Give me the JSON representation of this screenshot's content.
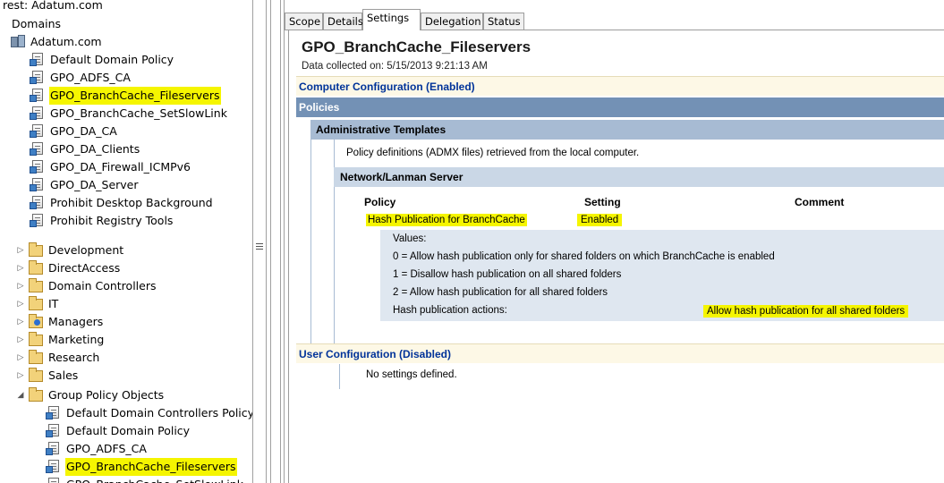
{
  "tree": {
    "partial_top": "rest: Adatum.com",
    "domains_label": "Domains",
    "domain_name": "Adatum.com",
    "linked_gpos": [
      {
        "label": "Default Domain Policy",
        "highlighted": false
      },
      {
        "label": "GPO_ADFS_CA",
        "highlighted": false
      },
      {
        "label": "GPO_BranchCache_Fileservers",
        "highlighted": true
      },
      {
        "label": "GPO_BranchCache_SetSlowLink",
        "highlighted": false
      },
      {
        "label": "GPO_DA_CA",
        "highlighted": false
      },
      {
        "label": "GPO_DA_Clients",
        "highlighted": false
      },
      {
        "label": "GPO_DA_Firewall_ICMPv6",
        "highlighted": false
      },
      {
        "label": "GPO_DA_Server",
        "highlighted": false
      },
      {
        "label": "Prohibit Desktop Background",
        "highlighted": false
      },
      {
        "label": "Prohibit Registry Tools",
        "highlighted": false
      }
    ],
    "ous": [
      {
        "label": "Development",
        "icon": "ou-icon"
      },
      {
        "label": "DirectAccess",
        "icon": "ou-icon"
      },
      {
        "label": "Domain Controllers",
        "icon": "ou-icon"
      },
      {
        "label": "IT",
        "icon": "ou-icon"
      },
      {
        "label": "Managers",
        "icon": "ou-icon-blue"
      },
      {
        "label": "Marketing",
        "icon": "ou-icon"
      },
      {
        "label": "Research",
        "icon": "ou-icon"
      },
      {
        "label": "Sales",
        "icon": "ou-icon"
      }
    ],
    "gpo_folder": "Group Policy Objects",
    "gpo_objects": [
      {
        "label": "Default Domain Controllers Policy",
        "highlighted": false
      },
      {
        "label": "Default Domain Policy",
        "highlighted": false
      },
      {
        "label": "GPO_ADFS_CA",
        "highlighted": false
      },
      {
        "label": "GPO_BranchCache_Fileservers",
        "highlighted": true
      },
      {
        "label": "GPO_BranchCache_SetSlowLink",
        "highlighted": false
      }
    ]
  },
  "tabs": [
    "Scope",
    "Details",
    "Settings",
    "Delegation",
    "Status"
  ],
  "active_tab": "Settings",
  "report": {
    "title": "GPO_BranchCache_Fileservers",
    "collected": "Data collected on: 5/15/2013 9:21:13 AM",
    "computer_config": "Computer Configuration (Enabled)",
    "policies": "Policies",
    "admin_templates": "Administrative Templates",
    "admx_note": "Policy definitions (ADMX files) retrieved from the local computer.",
    "network_section": "Network/Lanman Server",
    "col_policy": "Policy",
    "col_setting": "Setting",
    "col_comment": "Comment",
    "policy_name": "Hash Publication for BranchCache",
    "policy_setting": "Enabled",
    "values_label": "Values:",
    "value_0": "0 = Allow hash publication only for shared folders on which BranchCache is enabled",
    "value_1": "1 = Disallow hash publication on all shared folders",
    "value_2": "2 = Allow hash publication for all shared folders",
    "actions_label": "Hash publication actions:",
    "actions_value": "Allow hash publication for all shared folders",
    "user_config": "User Configuration (Disabled)",
    "no_settings": "No settings defined."
  },
  "colors": {
    "highlight": "#f5f500",
    "section_header_text": "#003399",
    "policies_band": "#7391b5",
    "admin_band": "#a7bbd3",
    "network_band": "#cad7e6"
  }
}
